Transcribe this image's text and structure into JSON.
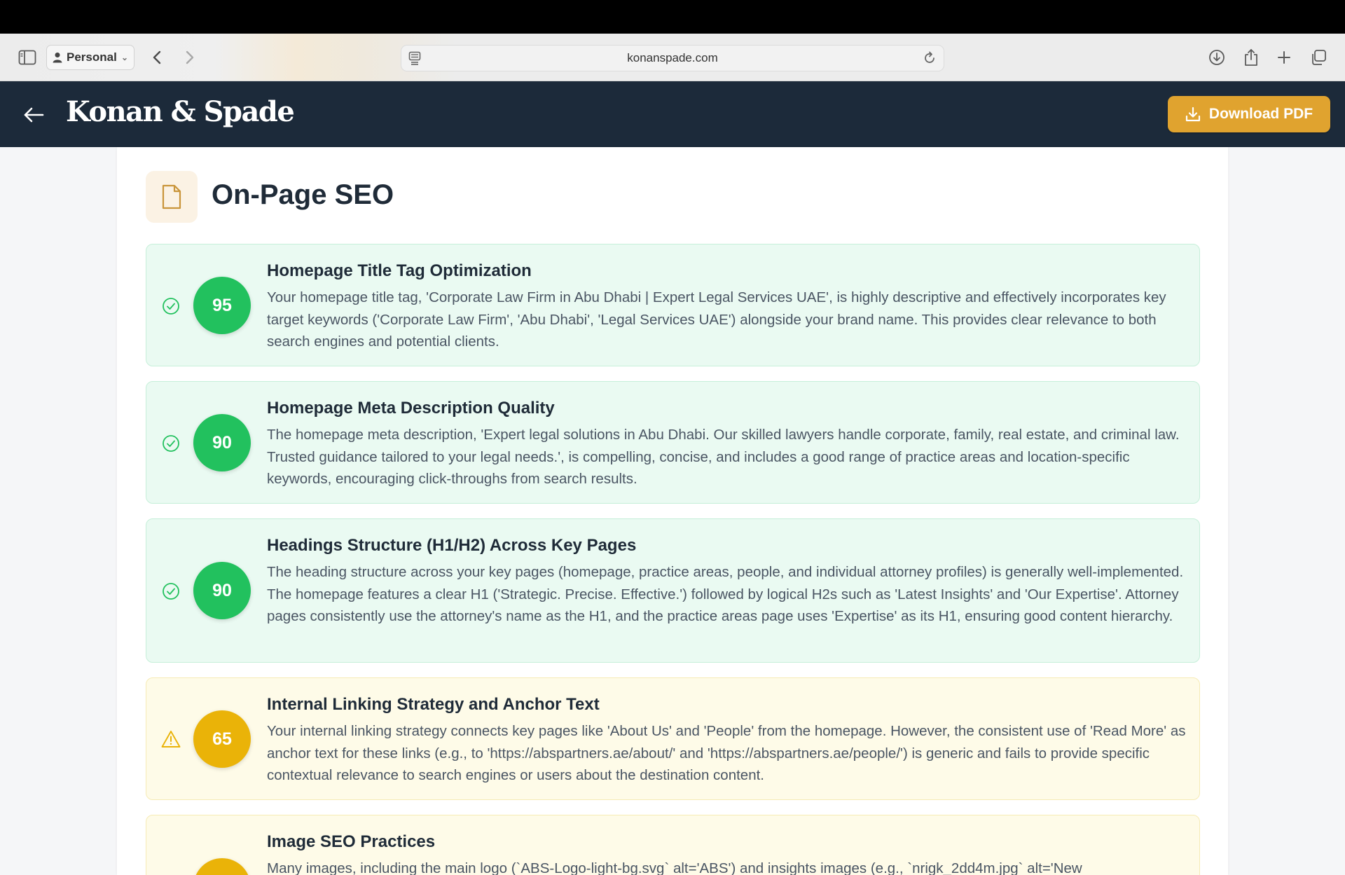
{
  "browser": {
    "profile_label": "Personal",
    "url": "konanspade.com"
  },
  "header": {
    "brand": "Konan & Spade",
    "download_label": "Download PDF"
  },
  "section": {
    "title": "On-Page SEO"
  },
  "items": [
    {
      "status": "pass",
      "score": "95",
      "title": "Homepage Title Tag Optimization",
      "description": "Your homepage title tag, 'Corporate Law Firm in Abu Dhabi | Expert Legal Services UAE', is highly descriptive and effectively incorporates key target keywords ('Corporate Law Firm', 'Abu Dhabi', 'Legal Services UAE') alongside your brand name. This provides clear relevance to both search engines and potential clients."
    },
    {
      "status": "pass",
      "score": "90",
      "title": "Homepage Meta Description Quality",
      "description": "The homepage meta description, 'Expert legal solutions in Abu Dhabi. Our skilled lawyers handle corporate, family, real estate, and criminal law. Trusted guidance tailored to your legal needs.', is compelling, concise, and includes a good range of practice areas and location-specific keywords, encouraging click-throughs from search results."
    },
    {
      "status": "pass",
      "score": "90",
      "title": "Headings Structure (H1/H2) Across Key Pages",
      "description": "The heading structure across your key pages (homepage, practice areas, people, and individual attorney profiles) is generally well-implemented. The homepage features a clear H1 ('Strategic. Precise. Effective.') followed by logical H2s such as 'Latest Insights' and 'Our Expertise'. Attorney pages consistently use the attorney's name as the H1, and the practice areas page uses 'Expertise' as its H1, ensuring good content hierarchy."
    },
    {
      "status": "warning",
      "score": "65",
      "title": "Internal Linking Strategy and Anchor Text",
      "description": "Your internal linking strategy connects key pages like 'About Us' and 'People' from the homepage. However, the consistent use of 'Read More' as anchor text for these links (e.g., to 'https://abspartners.ae/about/' and 'https://abspartners.ae/people/') is generic and fails to provide specific contextual relevance to search engines or users about the destination content."
    },
    {
      "status": "warning",
      "score": "",
      "title": "Image SEO Practices",
      "description": "Many images, including the main logo (`ABS-Logo-light-bg.svg` alt='ABS') and insights images (e.g., `nrigk_2dd4m.jpg` alt='New"
    }
  ],
  "colors": {
    "header_bg": "#1c2a3a",
    "accent": "#e0a32f",
    "pass": "#22c15e",
    "warning": "#eab308"
  }
}
